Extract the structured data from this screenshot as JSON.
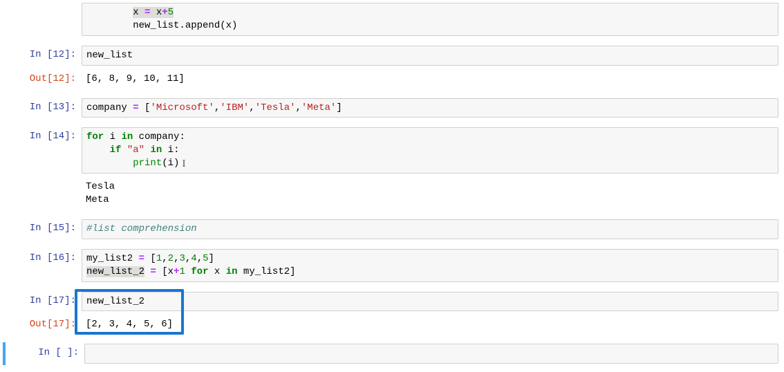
{
  "cells": {
    "c11_partial": {
      "line1_a": "x ",
      "line1_b": "=",
      "line1_c": " x",
      "line1_d": "+",
      "line1_e": "5",
      "line2": "new_list.append(x)"
    },
    "c12": {
      "in_prompt": "In [12]:",
      "code": "new_list",
      "out_prompt": "Out[12]:",
      "out": "[6, 8, 9, 10, 11]"
    },
    "c13": {
      "in_prompt": "In [13]:",
      "a": "company ",
      "b": "=",
      "c": " [",
      "s1": "'Microsoft'",
      "s2": "'IBM'",
      "s3": "'Tesla'",
      "s4": "'Meta'",
      "comma": ",",
      "close": "]"
    },
    "c14": {
      "in_prompt": "In [14]:",
      "for": "for",
      "sp": " ",
      "i": "i ",
      "in": "in",
      "company": " company:",
      "if": "if",
      "str_a": "\"a\"",
      "in2": "in",
      "i2": " i:",
      "print": "print",
      "p_args": "(i)",
      "out1": "Tesla",
      "out2": "Meta"
    },
    "c15": {
      "in_prompt": "In [15]:",
      "comment": "#list comprehension"
    },
    "c16": {
      "in_prompt": "In [16]:",
      "l1_a": "my_list2 ",
      "l1_b": "=",
      "l1_c": " [",
      "n1": "1",
      "n2": "2",
      "n3": "3",
      "n4": "4",
      "n5": "5",
      "comma": ",",
      "close": "]",
      "l2_a": "new_list_2",
      "l2_b": " ",
      "l2_c": "=",
      "l2_d": " [x",
      "l2_e": "+",
      "l2_f": "1",
      "l2_g": " ",
      "for": "for",
      "l2_h": " x ",
      "in": "in",
      "l2_i": " my_list2]"
    },
    "c17": {
      "in_prompt": "In [17]:",
      "code": "new_list_2",
      "out_prompt": "Out[17]:",
      "out": "[2, 3, 4, 5, 6]"
    },
    "c_empty": {
      "in_prompt": "In [ ]:",
      "code": ""
    }
  }
}
